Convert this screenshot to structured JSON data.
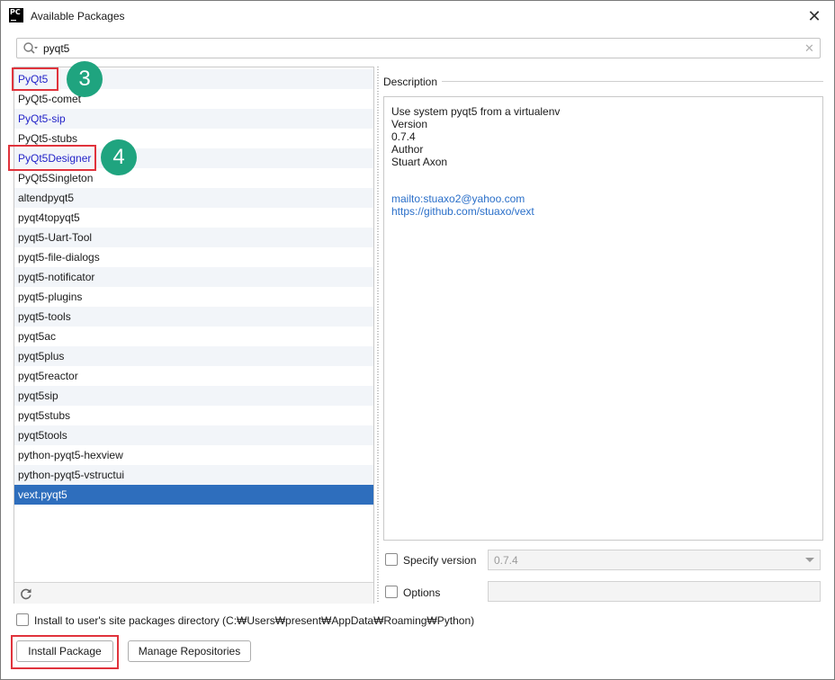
{
  "window": {
    "title": "Available Packages",
    "app_icon_text": "PC",
    "close_glyph": "✕"
  },
  "search": {
    "value": "pyqt5",
    "placeholder": "",
    "icon": "search-icon",
    "clear_icon": "close-icon"
  },
  "packages": {
    "items": [
      {
        "label": "PyQt5",
        "style": "blue"
      },
      {
        "label": "PyQt5-comet",
        "style": "normal"
      },
      {
        "label": "PyQt5-sip",
        "style": "blue"
      },
      {
        "label": "PyQt5-stubs",
        "style": "normal"
      },
      {
        "label": "PyQt5Designer",
        "style": "blue"
      },
      {
        "label": "PyQt5Singleton",
        "style": "normal"
      },
      {
        "label": "altendpyqt5",
        "style": "normal"
      },
      {
        "label": "pyqt4topyqt5",
        "style": "normal"
      },
      {
        "label": "pyqt5-Uart-Tool",
        "style": "normal"
      },
      {
        "label": "pyqt5-file-dialogs",
        "style": "normal"
      },
      {
        "label": "pyqt5-notificator",
        "style": "normal"
      },
      {
        "label": "pyqt5-plugins",
        "style": "normal"
      },
      {
        "label": "pyqt5-tools",
        "style": "normal"
      },
      {
        "label": "pyqt5ac",
        "style": "normal"
      },
      {
        "label": "pyqt5plus",
        "style": "normal"
      },
      {
        "label": "pyqt5reactor",
        "style": "normal"
      },
      {
        "label": "pyqt5sip",
        "style": "normal"
      },
      {
        "label": "pyqt5stubs",
        "style": "normal"
      },
      {
        "label": "pyqt5tools",
        "style": "normal"
      },
      {
        "label": "python-pyqt5-hexview",
        "style": "normal"
      },
      {
        "label": "python-pyqt5-vstructui",
        "style": "normal"
      },
      {
        "label": "vext.pyqt5",
        "style": "selected"
      }
    ],
    "selected": "vext.pyqt5",
    "refresh_icon": "refresh-icon"
  },
  "description": {
    "label": "Description",
    "lines": [
      "Use system pyqt5 from a virtualenv",
      "Version",
      "0.7.4",
      "Author",
      "Stuart Axon"
    ],
    "links": [
      "mailto:stuaxo2@yahoo.com",
      "https://github.com/stuaxo/vext"
    ]
  },
  "specify_version": {
    "label": "Specify version",
    "checked": false,
    "value": "0.7.4"
  },
  "options": {
    "label": "Options",
    "checked": false,
    "value": ""
  },
  "install_user": {
    "label": "Install to user's site packages directory (C:₩Users₩present₩AppData₩Roaming₩Python)",
    "checked": false
  },
  "buttons": {
    "install": "Install Package",
    "manage": "Manage Repositories"
  },
  "annotations": [
    {
      "number": "3",
      "target": "PyQt5"
    },
    {
      "number": "4",
      "target": "PyQt5Designer"
    },
    {
      "number": "",
      "target": "Install Package"
    }
  ],
  "colors": {
    "annotation_border": "#e0333c",
    "annotation_badge": "#1fa47f",
    "selection": "#2e6ebd",
    "link": "#2a6fc9",
    "installed_blue": "#2323c8"
  }
}
